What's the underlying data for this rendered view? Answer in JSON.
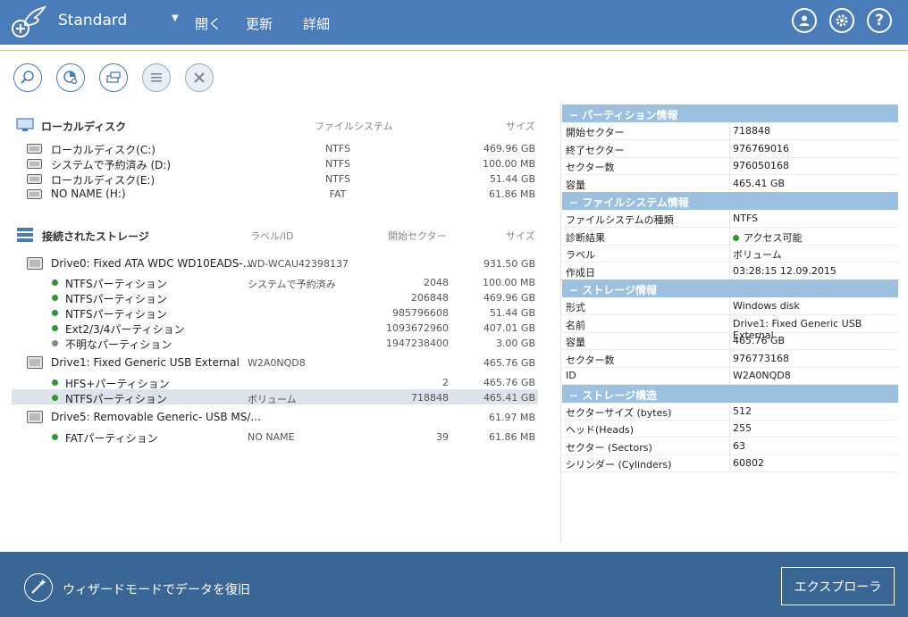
{
  "app": {
    "title": "Standard",
    "menu": [
      "開く",
      "更新",
      "詳細"
    ]
  },
  "local_disks": {
    "header": "ローカルディスク",
    "col_fs": "ファイルシステム",
    "col_size": "サイズ",
    "items": [
      {
        "name": "ローカルディスク(C:)",
        "fs": "NTFS",
        "size": "469.96 GB"
      },
      {
        "name": "システムで予約済み (D:)",
        "fs": "NTFS",
        "size": "100.00 MB"
      },
      {
        "name": "ローカルディスク(E:)",
        "fs": "NTFS",
        "size": "51.44 GB"
      },
      {
        "name": "NO NAME (H:)",
        "fs": "FAT",
        "size": "61.86 MB"
      }
    ]
  },
  "storage": {
    "header": "接続されたストレージ",
    "col_label": "ラベル/ID",
    "col_start": "開始セクター",
    "col_size": "サイズ",
    "rows": [
      {
        "name": "Drive0: Fixed ATA WDC WD10EADS-...",
        "label": "WD-WCAU42398137",
        "start": "",
        "size": "931.50 GB"
      },
      {
        "name": "NTFSパーティション",
        "label": "システムで予約済み",
        "start": "2048",
        "size": "100.00 MB"
      },
      {
        "name": "NTFSパーティション",
        "label": "",
        "start": "206848",
        "size": "469.96 GB"
      },
      {
        "name": "NTFSパーティション",
        "label": "",
        "start": "985796608",
        "size": "51.44 GB"
      },
      {
        "name": "Ext2/3/4パーティション",
        "label": "",
        "start": "1093672960",
        "size": "407.01 GB"
      },
      {
        "name": "不明なパーティション",
        "label": "",
        "start": "1947238400",
        "size": "3.00 GB"
      },
      {
        "name": "Drive1: Fixed Generic USB External",
        "label": "W2A0NQD8",
        "start": "",
        "size": "465.76 GB"
      },
      {
        "name": "HFS+パーティション",
        "label": "",
        "start": "2",
        "size": "465.76 GB"
      },
      {
        "name": "NTFSパーティション",
        "label": "ボリューム",
        "start": "718848",
        "size": "465.41 GB"
      },
      {
        "name": "Drive5: Removable Generic- USB MS/...",
        "label": "",
        "start": "",
        "size": "61.97 MB"
      },
      {
        "name": "FATパーティション",
        "label": "NO NAME",
        "start": "39",
        "size": "61.86 MB"
      }
    ]
  },
  "info": {
    "sections": [
      {
        "title": "パーティション情報",
        "rows": [
          {
            "k": "開始セクター",
            "v": "718848"
          },
          {
            "k": "終了セクター",
            "v": "976769016"
          },
          {
            "k": "セクター数",
            "v": "976050168"
          },
          {
            "k": "容量",
            "v": "465.41 GB"
          }
        ]
      },
      {
        "title": "ファイルシステム情報",
        "rows": [
          {
            "k": "ファイルシステムの種類",
            "v": "NTFS"
          },
          {
            "k": "診断結果",
            "v": "アクセス可能"
          },
          {
            "k": "ラベル",
            "v": "ボリューム"
          },
          {
            "k": "作成日",
            "v": "03:28:15 12.09.2015"
          }
        ]
      },
      {
        "title": "ストレージ情報",
        "rows": [
          {
            "k": "形式",
            "v": "Windows disk"
          },
          {
            "k": "名前",
            "v": "Drive1: Fixed Generic USB External"
          },
          {
            "k": "容量",
            "v": "465.76 GB"
          },
          {
            "k": "セクター数",
            "v": "976773168"
          },
          {
            "k": "ID",
            "v": "W2A0NQD8"
          }
        ]
      },
      {
        "title": "ストレージ構造",
        "rows": [
          {
            "k": "セクターサイズ (bytes)",
            "v": "512"
          },
          {
            "k": "ヘッド(Heads)",
            "v": "255"
          },
          {
            "k": "セクター (Sectors)",
            "v": "63"
          },
          {
            "k": "シリンダー (Cylinders)",
            "v": "60802"
          }
        ]
      }
    ]
  },
  "footer": {
    "wizard": "ウィザードモードでデータを復旧",
    "explorer": "エクスプローラ"
  },
  "colors": {
    "header": "#4a7cb9",
    "footer": "#3a6696",
    "section": "#9cc0e0",
    "ok_dot": "#2e9a2e",
    "unknown_dot": "#888888"
  }
}
